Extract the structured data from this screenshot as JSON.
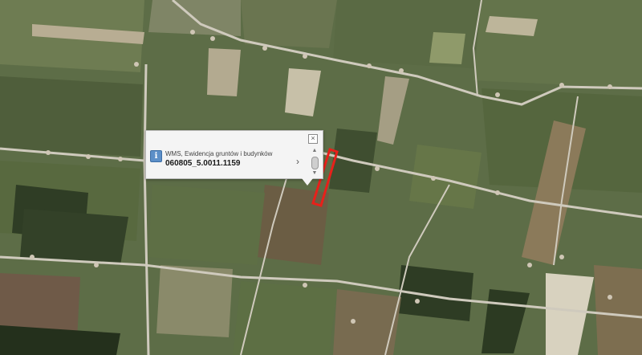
{
  "popup": {
    "layer_name": "WMS, Ewidencja gruntów i budynków",
    "feature_id": "060805_5.0011.1159",
    "close_glyph": "×",
    "icon_glyph": "i",
    "next_glyph": "›",
    "scroll_up_glyph": "▲",
    "scroll_down_glyph": "▼"
  },
  "colors": {
    "highlight": "#e8201a",
    "road": "#c9c4b8",
    "field_dark": "#4e5e3a",
    "field_light": "#a6a189"
  },
  "icons": [
    "close-icon",
    "info-icon",
    "chevron-right-icon",
    "scroll-up-icon",
    "scroll-down-icon"
  ]
}
